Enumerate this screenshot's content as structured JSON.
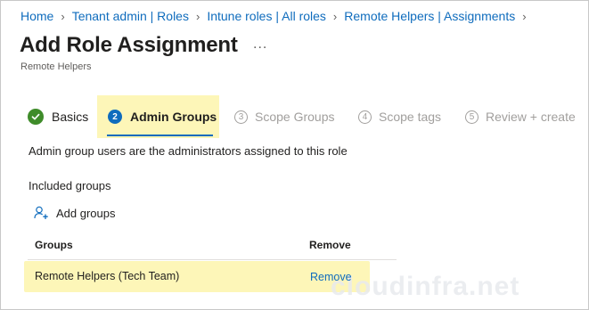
{
  "breadcrumb": [
    "Home",
    "Tenant admin | Roles",
    "Intune roles | All roles",
    "Remote Helpers | Assignments"
  ],
  "header": {
    "title": "Add Role Assignment",
    "subtitle": "Remote Helpers",
    "more": "..."
  },
  "wizard": {
    "steps": [
      {
        "number": "1",
        "label": "Basics",
        "state": "completed"
      },
      {
        "number": "2",
        "label": "Admin Groups",
        "state": "active"
      },
      {
        "number": "3",
        "label": "Scope Groups",
        "state": "pending"
      },
      {
        "number": "4",
        "label": "Scope tags",
        "state": "pending"
      },
      {
        "number": "5",
        "label": "Review + create",
        "state": "pending"
      }
    ],
    "completed_color": "#3f8c2a",
    "active_color": "#0f6cbd"
  },
  "content": {
    "description": "Admin group users are the administrators assigned to this role",
    "included_label": "Included groups",
    "add_groups_label": "Add groups",
    "add_icon": "add-person-icon"
  },
  "table": {
    "columns": [
      "Groups",
      "Remove"
    ],
    "rows": [
      {
        "group": "Remote Helpers (Tech Team)",
        "action": "Remove"
      }
    ]
  },
  "watermark": "cloudinfra.net",
  "colors": {
    "link": "#0f6cbd",
    "highlight": "#fdf6b8"
  }
}
